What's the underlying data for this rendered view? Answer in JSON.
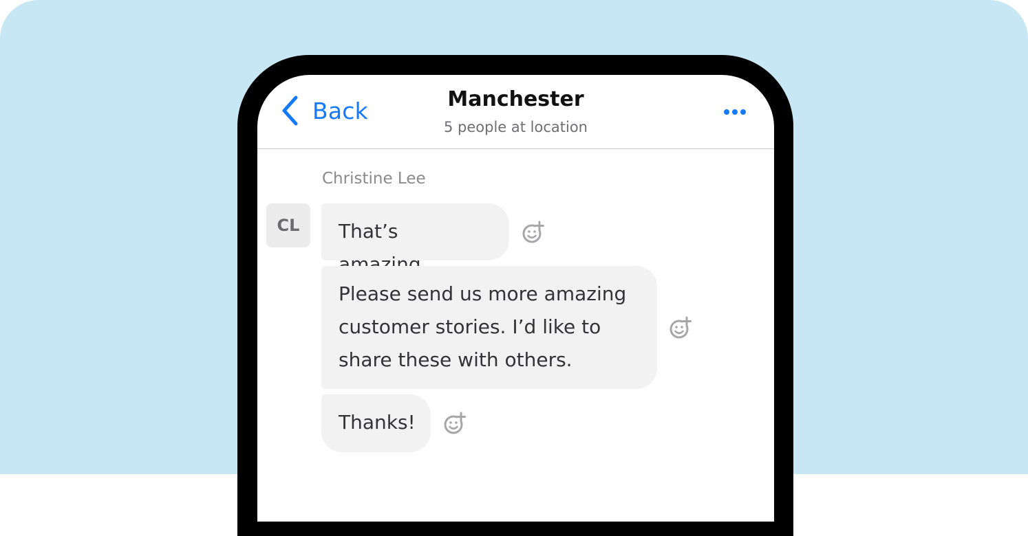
{
  "header": {
    "back_label": "Back",
    "title": "Manchester",
    "subtitle": "5 people at location",
    "more_icon": "ellipsis-icon",
    "accent_color": "#1479fb"
  },
  "conversation": {
    "sender_name": "Christine Lee",
    "avatar_initials": "CL",
    "messages": [
      {
        "text": "That’s amazing.",
        "reaction_icon": "add-reaction-icon"
      },
      {
        "text": "Please send us more amazing\ncustomer stories. I’d like to\nshare these with others.",
        "reaction_icon": "add-reaction-icon"
      },
      {
        "text": "Thanks!",
        "reaction_icon": "add-reaction-icon"
      }
    ]
  },
  "colors": {
    "background": "#c8e7f4",
    "bubble": "#f2f2f3",
    "frame": "#000000"
  }
}
